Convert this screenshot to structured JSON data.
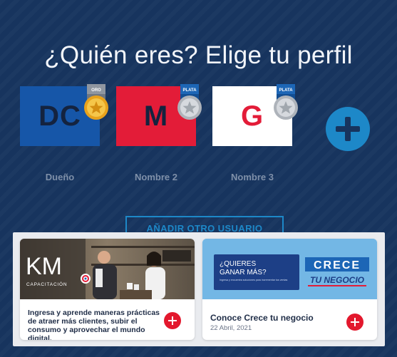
{
  "title": "¿Quién eres? Elige tu perfil",
  "profiles": [
    {
      "initials": "DC",
      "name": "Dueño",
      "badge": "ORO",
      "tile_color": "#1656a8",
      "text_color": "#14233f"
    },
    {
      "initials": "M",
      "name": "Nombre 2",
      "badge": "PLATA",
      "tile_color": "#e31c38",
      "text_color": "#14233f"
    },
    {
      "initials": "G",
      "name": "Nombre 3",
      "badge": "PLATA",
      "tile_color": "#ffffff",
      "text_color": "#e31c38"
    }
  ],
  "add_profile_icon": "plus-icon",
  "add_user_label": "AÑADIR OTRO USUARIO",
  "cards": [
    {
      "logo_text": "KM",
      "logo_sub": "CAPACITACIÓN",
      "text": "Ingresa y aprende maneras prácticas de atraer más clientes, subir el consumo y aprovechar el mundo digital."
    },
    {
      "banner_q": "¿QUIERES GANAR MÁS?",
      "banner_small": "Ingresa y encuentra soluciones para incrementar tus ventas",
      "brand_top": "CRECE",
      "brand_bottom": "TU NEGOCIO",
      "title": "Conoce Crece tu negocio",
      "date": "22 Abril, 2021"
    }
  ],
  "colors": {
    "background": "#17345e",
    "accent": "#1d88c8",
    "red": "#e31c38",
    "gold": "#f0b52a",
    "silver": "#c9cdd3"
  }
}
